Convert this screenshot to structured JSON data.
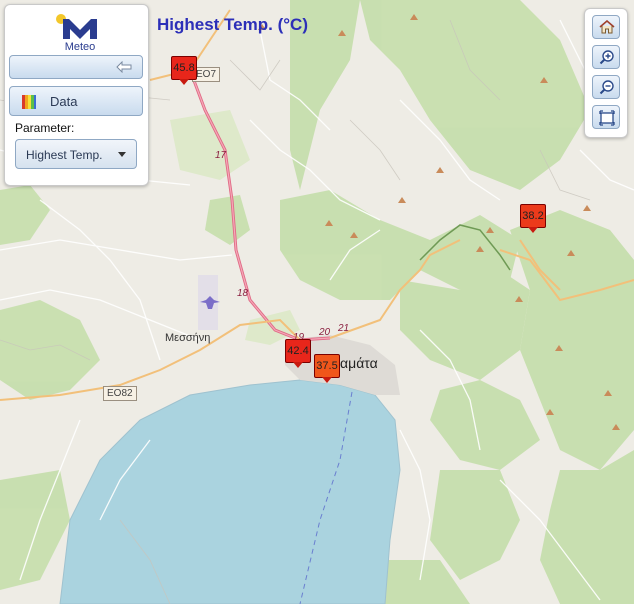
{
  "app": {
    "logo_text": "Meteo"
  },
  "map": {
    "title": "Highest Temp. (°C)",
    "places": [
      {
        "name": "Μεσσήνη"
      },
      {
        "name": "Καλαμάτα"
      }
    ],
    "road_labels": [
      "17",
      "18",
      "19",
      "20",
      "21"
    ],
    "road_shields": [
      "EO82",
      "EO7"
    ],
    "markers": [
      {
        "value": "45.8",
        "color": "#e8261b"
      },
      {
        "value": "42.4",
        "color": "#e8261b"
      },
      {
        "value": "37.5",
        "color": "#f0561b"
      },
      {
        "value": "38.2",
        "color": "#ec3a1b"
      }
    ]
  },
  "panel": {
    "data_button": "Data",
    "parameter_label": "Parameter:",
    "parameter_value": "Highest Temp."
  },
  "controls": [
    "home-icon",
    "zoom-in-icon",
    "zoom-out-icon",
    "zoom-extent-icon"
  ]
}
